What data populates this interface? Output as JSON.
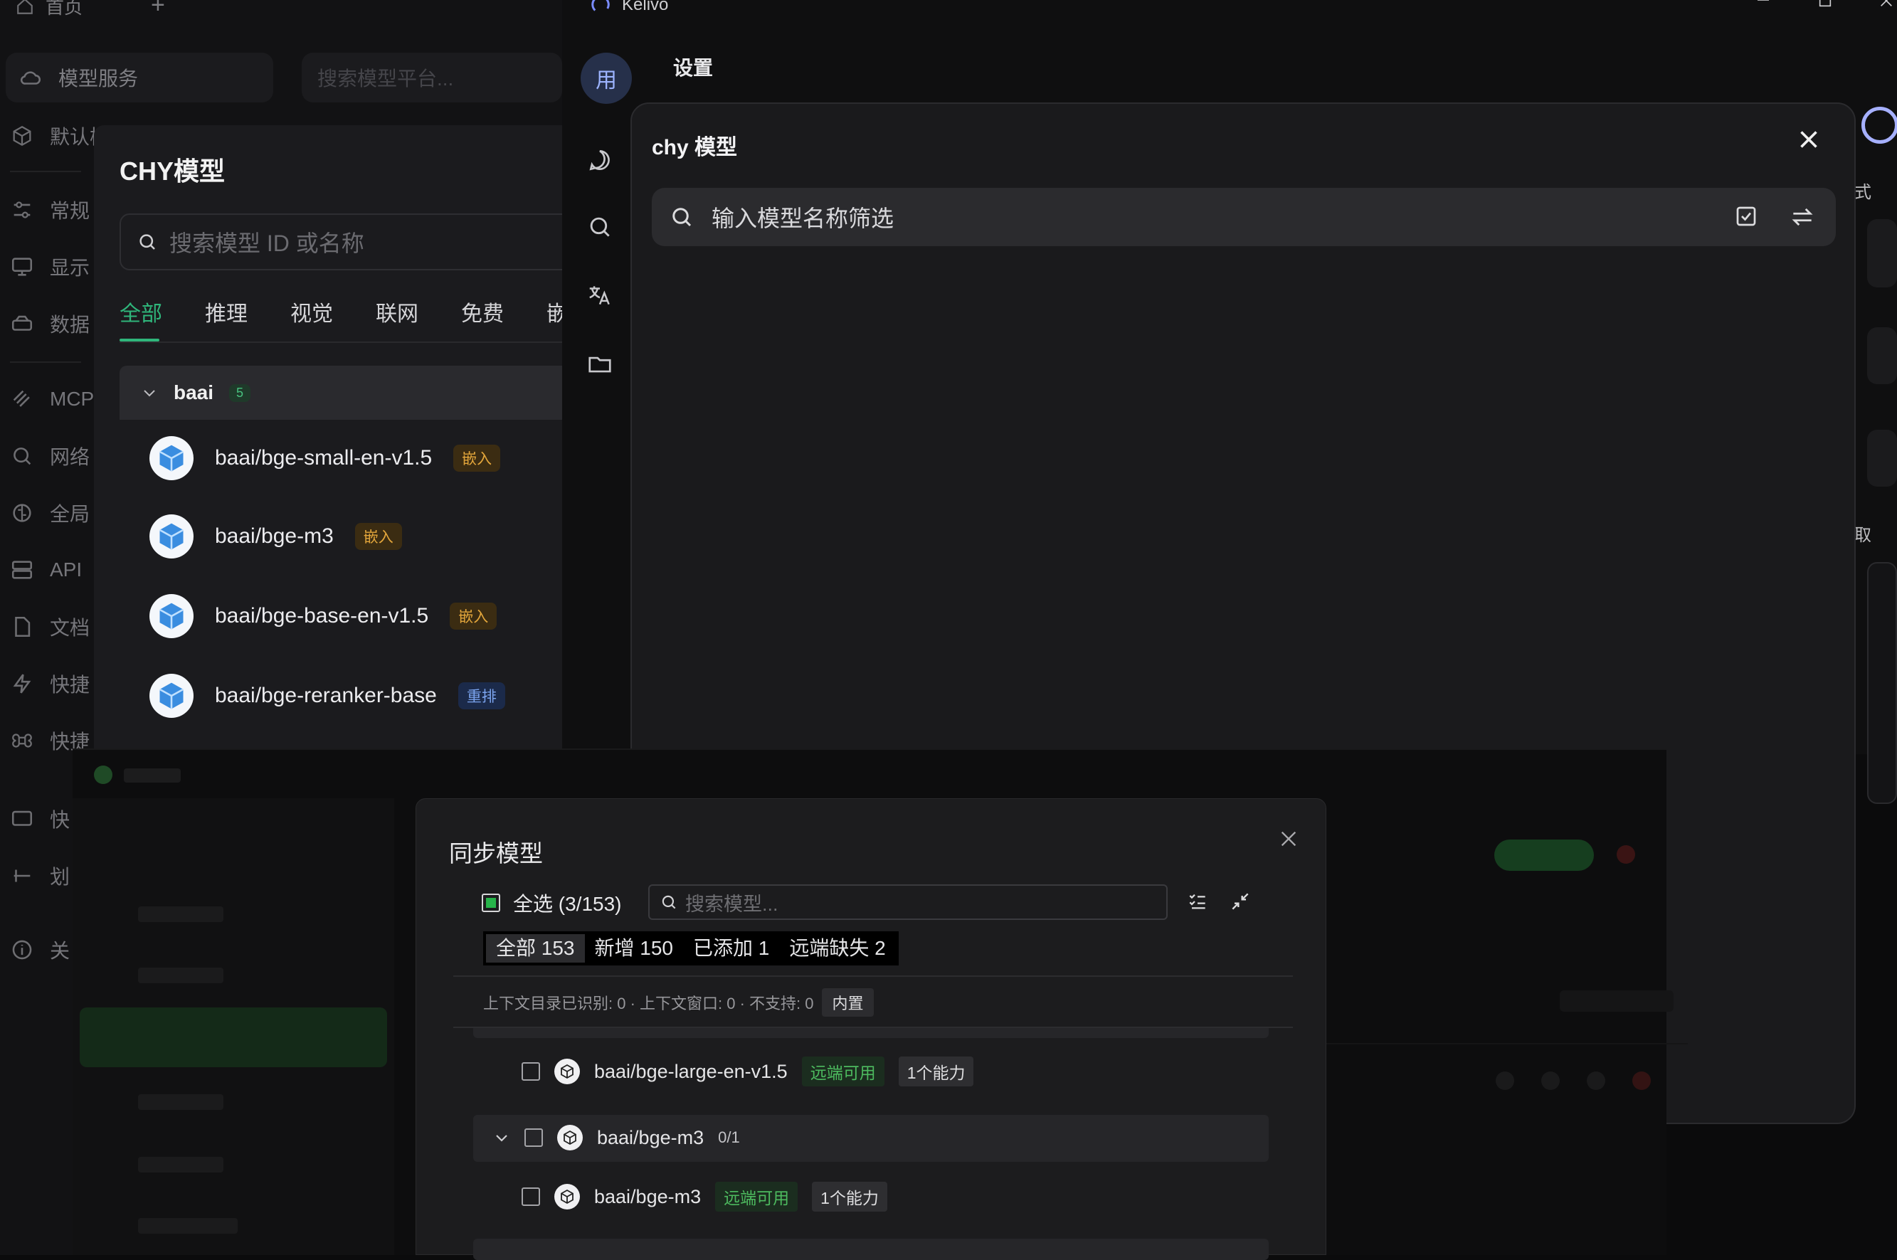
{
  "background_app": {
    "topbar": {
      "home_label": "首页",
      "add_label": "+"
    },
    "nav": {
      "model_service": "模型服务",
      "search_placeholder": "搜索模型平台...",
      "items": [
        "默认模",
        "常规",
        "显示",
        "数据",
        "MCP",
        "网络",
        "全局",
        "API",
        "文档",
        "快捷",
        "快捷",
        "快",
        "划",
        "关"
      ]
    },
    "chy_panel": {
      "title": "CHY模型",
      "search_placeholder": "搜索模型 ID 或名称",
      "tabs": [
        "全部",
        "推理",
        "视觉",
        "联网",
        "免费",
        "嵌"
      ],
      "group": {
        "name": "baai",
        "count": "5"
      },
      "models": [
        {
          "name": "baai/bge-small-en-v1.5",
          "tag": "嵌入",
          "tag_kind": "embed"
        },
        {
          "name": "baai/bge-m3",
          "tag": "嵌入",
          "tag_kind": "embed"
        },
        {
          "name": "baai/bge-base-en-v1.5",
          "tag": "嵌入",
          "tag_kind": "embed"
        },
        {
          "name": "baai/bge-reranker-base",
          "tag": "重排",
          "tag_kind": "rerank"
        }
      ]
    }
  },
  "kelivo": {
    "app_name": "Kelivo",
    "avatar_char": "用",
    "settings_title": "设置",
    "right_edge_chars": [
      "式",
      "取"
    ],
    "dialog": {
      "title": "chy 模型",
      "search_placeholder": "输入模型名称筛选"
    }
  },
  "sync_dialog": {
    "title": "同步模型",
    "select_all": "全选 (3/153)",
    "search_placeholder": "搜索模型...",
    "segments": [
      "全部 153",
      "新增 150",
      "已添加 1",
      "远端缺失 2"
    ],
    "info_text": "上下文目录已识别: 0 · 上下文窗口: 0 · 不支持: 0",
    "info_chip": "内置",
    "rows": [
      {
        "name": "baai/bge-large-en-v1.5",
        "status": "远端可用",
        "caps": "1个能力"
      },
      {
        "group": "baai/bge-m3",
        "count": "0/1"
      },
      {
        "name": "baai/bge-m3",
        "status": "远端可用",
        "caps": "1个能力"
      }
    ]
  },
  "colors": {
    "accent_green": "#2fb67b",
    "embed_tag": "#e3a63b",
    "rerank_tag": "#7ba4ef",
    "check_green": "#27b34a"
  }
}
